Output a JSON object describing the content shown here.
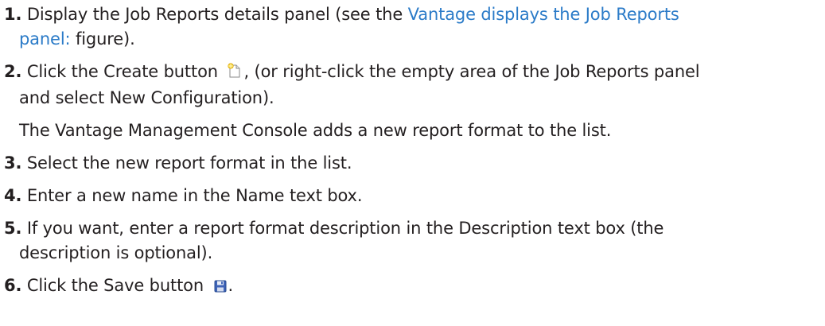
{
  "steps": [
    {
      "number": "1.",
      "text_before_link": " Display the Job Reports details panel (see the ",
      "link_line1": "Vantage displays the Job Reports",
      "link_line2": "panel:",
      "text_after_link": " figure)."
    },
    {
      "number": "2.",
      "text_before_icon": " Click the Create button ",
      "icon": "new-document-icon",
      "text_after_icon": ", (or right-click the empty area of the Job Reports panel",
      "continuation": "and select New Configuration).",
      "result": "The Vantage Management Console adds a new report format to the list."
    },
    {
      "number": "3.",
      "text": " Select the new report format in the list."
    },
    {
      "number": "4.",
      "text": " Enter a new name in the Name text box."
    },
    {
      "number": "5.",
      "text": " If you want, enter a report format description in the Description text box (the",
      "continuation": "description is optional)."
    },
    {
      "number": "6.",
      "text_before_icon": " Click the Save button ",
      "icon": "save-disk-icon",
      "text_after_icon": "."
    }
  ],
  "colors": {
    "text": "#231f20",
    "link": "#2b7bc8"
  }
}
